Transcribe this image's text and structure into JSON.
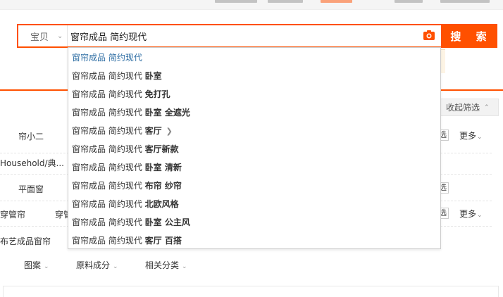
{
  "search": {
    "scope_label": "宝贝",
    "query": "窗帘成品 简约现代",
    "button_label": "搜 索"
  },
  "suggestions": [
    {
      "base": "窗帘成品 简约现代",
      "keyword": ""
    },
    {
      "base": "窗帘成品 简约现代",
      "keyword": "卧室"
    },
    {
      "base": "窗帘成品 简约现代",
      "keyword": "免打孔"
    },
    {
      "base": "窗帘成品 简约现代",
      "keyword": "卧室 全遮光"
    },
    {
      "base": "窗帘成品 简约现代",
      "keyword": "客厅"
    },
    {
      "base": "窗帘成品 简约现代",
      "keyword": "客厅新款"
    },
    {
      "base": "窗帘成品 简约现代",
      "keyword": "卧室 清新"
    },
    {
      "base": "窗帘成品 简约现代",
      "keyword": "布帘 纱帘"
    },
    {
      "base": "窗帘成品 简约现代",
      "keyword": "北欧风格"
    },
    {
      "base": "窗帘成品 简约现代",
      "keyword": "卧室 公主风"
    },
    {
      "base": "窗帘成品 简约现代",
      "keyword": "客厅 百搭"
    }
  ],
  "filters": {
    "collapse_label": "收起筛选",
    "row1_label": "帘小二",
    "row1_option": "选",
    "row1_more": "更多",
    "row2_label": "Household/典...",
    "row3_label": "平面窗",
    "row3_option": "选",
    "row4_label_a": "穿管帘",
    "row4_label_b": "穿管",
    "row4_option": "选",
    "row4_more": "更多",
    "row5_label": "布艺成品窗帘"
  },
  "bottom_tabs": [
    "图案",
    "原料成分",
    "相关分类"
  ]
}
